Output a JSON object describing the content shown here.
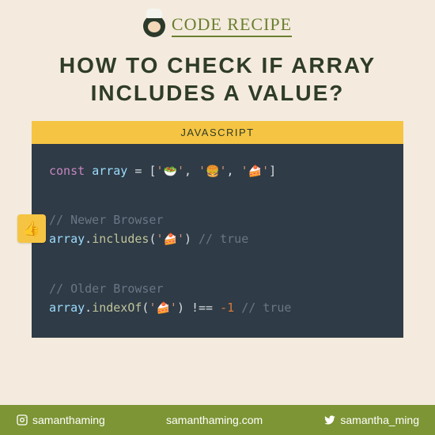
{
  "brand": "CODE RECIPE",
  "title_line1": "HOW TO CHECK IF ARRAY",
  "title_line2": "INCLUDES A VALUE?",
  "code_tab": "JAVASCRIPT",
  "emojis": {
    "salad": "🥗",
    "burger": "🍔",
    "cake": "🍰",
    "thumb": "👍"
  },
  "code": {
    "const": "const",
    "arr": "array",
    "eq": " = ",
    "br_open": "[",
    "q": "'",
    "comma": ", ",
    "br_close": "]",
    "cmt_new": "// Newer Browser",
    "includes": "includes",
    "dot": ".",
    "p_open": "(",
    "p_close": ")",
    "true_cmt": " // true",
    "cmt_old": "// Older Browser",
    "indexof": "indexOf",
    "neq": " !== ",
    "neg1": "-1"
  },
  "footer": {
    "ig": "samanthaming",
    "site": "samanthaming.com",
    "tw": "samantha_ming"
  }
}
